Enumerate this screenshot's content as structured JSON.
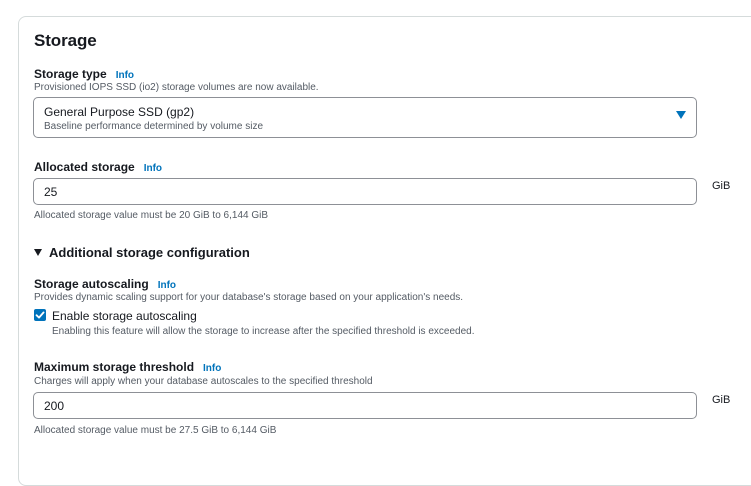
{
  "storage": {
    "title": "Storage",
    "storage_type": {
      "label": "Storage type",
      "info": "Info",
      "description": "Provisioned IOPS SSD (io2) storage volumes are now available.",
      "selected": "General Purpose SSD (gp2)",
      "selected_description": "Baseline performance determined by volume size"
    },
    "allocated_storage": {
      "label": "Allocated storage",
      "info": "Info",
      "value": "25",
      "unit": "GiB",
      "constraint": "Allocated storage value must be 20 GiB to 6,144 GiB"
    },
    "additional": {
      "title": "Additional storage configuration",
      "expanded": true
    },
    "autoscaling": {
      "label": "Storage autoscaling",
      "info": "Info",
      "description": "Provides dynamic scaling support for your database's storage based on your application's needs.",
      "checkbox_label": "Enable storage autoscaling",
      "checked": true,
      "checkbox_description": "Enabling this feature will allow the storage to increase after the specified threshold is exceeded."
    },
    "max_threshold": {
      "label": "Maximum storage threshold",
      "info": "Info",
      "description": "Charges will apply when your database autoscales to the specified threshold",
      "value": "200",
      "unit": "GiB",
      "constraint": "Allocated storage value must be 27.5 GiB to 6,144 GiB"
    }
  },
  "colors": {
    "accent": "#0073bb",
    "text": "#16191f",
    "muted": "#545b64",
    "border": "#8d9096"
  }
}
